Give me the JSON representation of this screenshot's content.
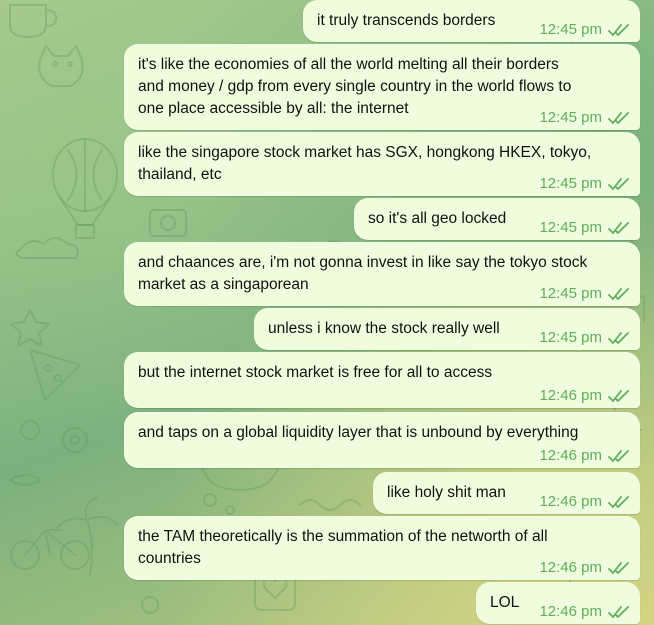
{
  "colors": {
    "bubble": "#effdde",
    "time": "#5fae5b",
    "check": "#5fae5b",
    "text": "#111111"
  },
  "status_icon": "double-check-read-icon",
  "messages": [
    {
      "lines": [
        "it truly transcends borders"
      ],
      "time": "12:45 pm"
    },
    {
      "lines": [
        "it's like the economies of all the world melting all their borders",
        "and money / gdp from every single country in the world flows to",
        "one place accessible by all: the internet"
      ],
      "time": "12:45 pm"
    },
    {
      "lines": [
        "like the singapore stock market has SGX, hongkong HKEX, tokyo,",
        "thailand, etc"
      ],
      "time": "12:45 pm"
    },
    {
      "lines": [
        "so it's all geo locked"
      ],
      "time": "12:45 pm"
    },
    {
      "lines": [
        "and chaances are, i'm not gonna invest in like say the tokyo stock",
        "market as a singaporean"
      ],
      "time": "12:45 pm"
    },
    {
      "lines": [
        "unless i know the stock really well"
      ],
      "time": "12:45 pm"
    },
    {
      "lines": [
        "but the internet stock market is free for all to access"
      ],
      "time": "12:46 pm"
    },
    {
      "lines": [
        "and taps on a global liquidity layer that is unbound by everything"
      ],
      "time": "12:46 pm"
    },
    {
      "lines": [
        "like holy shit man"
      ],
      "time": "12:46 pm"
    },
    {
      "lines": [
        "the TAM theoretically is the summation of the networth of all",
        "countries"
      ],
      "time": "12:46 pm"
    },
    {
      "lines": [
        "LOL"
      ],
      "time": "12:46 pm"
    }
  ]
}
